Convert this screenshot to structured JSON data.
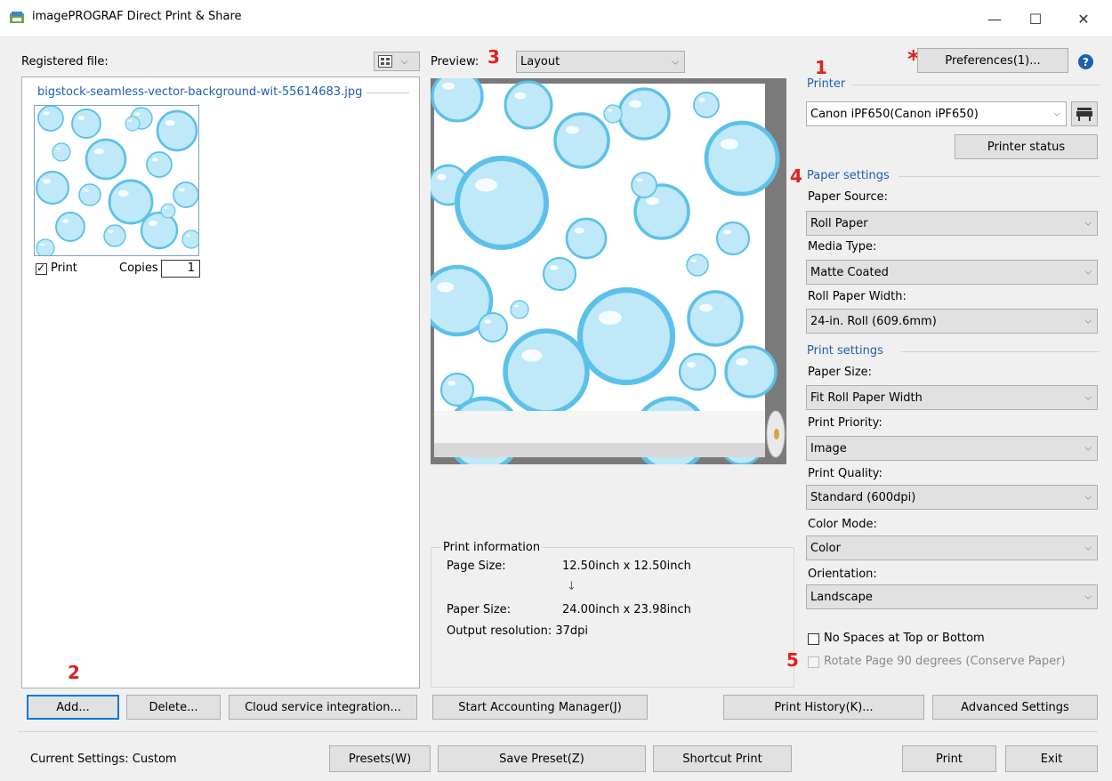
{
  "window": {
    "title": "imagePROGRAF Direct Print & Share",
    "minimize": "—",
    "maximize": "☐",
    "close": "✕"
  },
  "left_panel": {
    "label": "Registered file:",
    "file_name": "bigstock-seamless-vector-background-wit-55614683.jpg",
    "print_label": "Print",
    "copies_label": "Copies",
    "copies_value": "1",
    "print_checked": true
  },
  "preview": {
    "label": "Preview:",
    "mode": "Layout"
  },
  "print_info": {
    "title": "Print information",
    "page_size_label": "Page Size:",
    "page_size_value": "12.50inch x 12.50inch",
    "arrow": "↓",
    "paper_size_label": "Paper Size:",
    "paper_size_value": "24.00inch x 23.98inch",
    "output_resolution": "Output resolution: 37dpi"
  },
  "right_panel": {
    "preferences": "Preferences(1)...",
    "help": "?",
    "printer_group": "Printer",
    "printer_value": "Canon iPF650(Canon iPF650)",
    "printer_status": "Printer status",
    "paper_group": "Paper settings",
    "paper_source_label": "Paper Source:",
    "paper_source_value": "Roll Paper",
    "media_type_label": "Media Type:",
    "media_type_value": "Matte Coated",
    "roll_width_label": "Roll Paper Width:",
    "roll_width_value": "24-in. Roll (609.6mm)",
    "print_group": "Print settings",
    "paper_size_label": "Paper Size:",
    "paper_size_value": "Fit Roll Paper Width",
    "print_priority_label": "Print Priority:",
    "print_priority_value": "Image",
    "print_quality_label": "Print Quality:",
    "print_quality_value": "Standard (600dpi)",
    "color_mode_label": "Color Mode:",
    "color_mode_value": "Color",
    "orientation_label": "Orientation:",
    "orientation_value": "Landscape",
    "no_spaces": "No Spaces at Top or Bottom",
    "rotate_page": "Rotate Page 90 degrees (Conserve Paper)"
  },
  "buttons": {
    "add": "Add...",
    "delete": "Delete...",
    "cloud": "Cloud service integration...",
    "accounting": "Start Accounting Manager(J)",
    "history": "Print History(K)...",
    "advanced": "Advanced Settings",
    "presets": "Presets(W)",
    "save_preset": "Save Preset(Z)",
    "shortcut": "Shortcut Print",
    "print": "Print",
    "exit": "Exit"
  },
  "status": {
    "current_settings": "Current Settings: Custom"
  },
  "markers": {
    "m1": "1",
    "m2": "2",
    "m3": "3",
    "m4": "4",
    "m5": "5",
    "star": "*"
  },
  "colors": {
    "accent_blue": "#1f5fb0",
    "marker_red": "#e02020",
    "bubble": "#5cc1ea"
  }
}
